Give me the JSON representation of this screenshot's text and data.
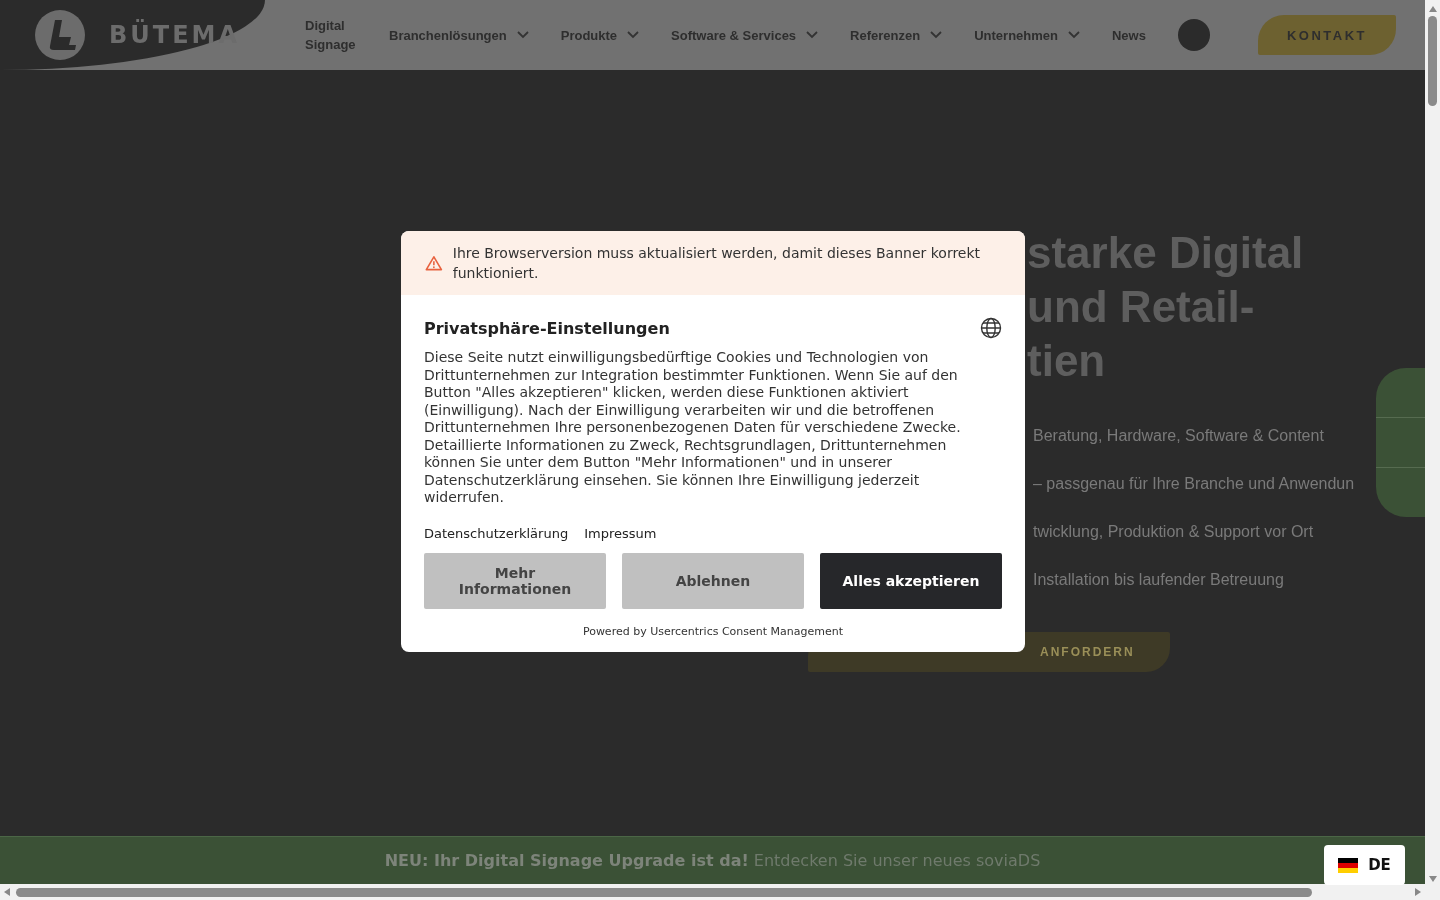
{
  "header": {
    "logo_text": "BÜTEMA",
    "nav": [
      {
        "label": "Digital Signage",
        "dropdown": false
      },
      {
        "label": "Branchenlösungen",
        "dropdown": true
      },
      {
        "label": "Produkte",
        "dropdown": true
      },
      {
        "label": "Software & Services",
        "dropdown": true
      },
      {
        "label": "Referenzen",
        "dropdown": true
      },
      {
        "label": "Unternehmen",
        "dropdown": true
      },
      {
        "label": "News",
        "dropdown": false
      }
    ],
    "contact_button": "KONTAKT"
  },
  "hero": {
    "heading_lines": [
      "starke Digital",
      "und Retail-",
      "tien"
    ],
    "features": [
      "Beratung, Hardware, Software & Content",
      "– passgenau für Ihre Branche und Anwendun",
      "twicklung, Produktion & Support vor Ort",
      "Installation bis laufender Betreuung"
    ],
    "cta": "ANFORDERN"
  },
  "consent": {
    "warning": "Ihre Browserversion muss aktualisiert werden, damit dieses Banner korrekt funktioniert.",
    "title": "Privatsphäre-Einstellungen",
    "body": "Diese Seite nutzt einwilligungsbedürftige Cookies und Technologien von Drittunternehmen zur Integration bestimmter Funktionen. Wenn Sie auf den Button \"Alles akzeptieren\" klicken, werden diese Funktionen aktiviert (Einwilligung). Nach der Einwilligung verarbeiten wir und die betroffenen Drittunternehmen Ihre personenbezogenen Daten für verschiedene Zwecke. Detaillierte Informationen zu Zweck, Rechtsgrundlagen, Drittunternehmen können Sie unter dem Button \"Mehr Informationen\" und in unserer Datenschutzerklärung einsehen. Sie können Ihre Einwilligung jederzeit widerrufen.",
    "links": [
      "Datenschutzerklärung",
      "Impressum"
    ],
    "buttons": [
      {
        "label": "Mehr Informationen",
        "kind": "secondary"
      },
      {
        "label": "Ablehnen",
        "kind": "secondary"
      },
      {
        "label": "Alles akzeptieren",
        "kind": "primary"
      }
    ],
    "powered_by": "Powered by Usercentrics Consent Management"
  },
  "announcement": "**NEU: Ihr Digital Signage Upgrade ist da!** Entdecken Sie unser neues soviaDS",
  "language": {
    "code": "DE"
  }
}
